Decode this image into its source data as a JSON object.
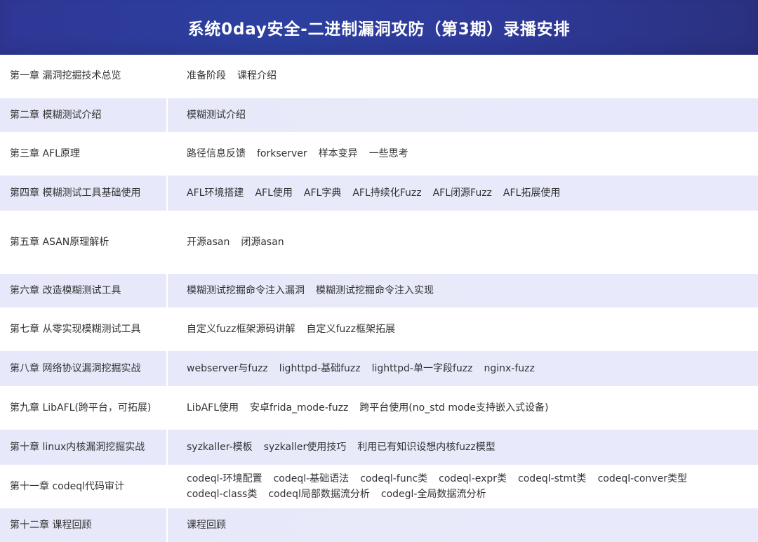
{
  "header": {
    "title": "系统0day安全-二进制漏洞攻防（第3期）录播安排"
  },
  "rows": [
    {
      "chapter": "第一章 漏洞挖掘技术总览",
      "topics": [
        "准备阶段",
        "课程介绍"
      ]
    },
    {
      "chapter": "第二章 模糊测试介绍",
      "topics": [
        "模糊测试介绍"
      ]
    },
    {
      "chapter": "第三章 AFL原理",
      "topics": [
        "路径信息反馈",
        "forkserver",
        "样本变异",
        "一些思考"
      ]
    },
    {
      "chapter": "第四章 模糊测试工具基础使用",
      "topics": [
        "AFL环境搭建",
        "AFL使用",
        "AFL字典",
        "AFL持续化Fuzz",
        "AFL闭源Fuzz",
        "AFL拓展使用"
      ]
    },
    {
      "chapter": "第五章 ASAN原理解析",
      "topics": [
        "开源asan",
        "闭源asan"
      ]
    },
    {
      "chapter": "第六章 改造模糊测试工具",
      "topics": [
        "模糊测试挖掘命令注入漏洞",
        "模糊测试挖掘命令注入实现"
      ]
    },
    {
      "chapter": "第七章 从零实现模糊测试工具",
      "topics": [
        "自定义fuzz框架源码讲解",
        "自定义fuzz框架拓展"
      ]
    },
    {
      "chapter": "第八章 网络协议漏洞挖掘实战",
      "topics": [
        "webserver与fuzz",
        "lighttpd-基础fuzz",
        "lighttpd-单一字段fuzz",
        "nginx-fuzz"
      ]
    },
    {
      "chapter": "第九章 LibAFL(跨平台，可拓展)",
      "topics": [
        "LibAFL使用",
        "安卓frida_mode-fuzz",
        "跨平台使用(no_std mode支持嵌入式设备)"
      ]
    },
    {
      "chapter": "第十章 linux内核漏洞挖掘实战",
      "topics": [
        "syzkaller-模板",
        "syzkaller使用技巧",
        "利用已有知识设想内核fuzz模型"
      ]
    },
    {
      "chapter": "第十一章 codeql代码审计",
      "topics": [
        "codeql-环境配置",
        "codeql-基础语法",
        "codeql-func类",
        "codeql-expr类",
        "codeql-stmt类",
        "codeql-conver类型",
        "codeql-class类",
        "codeql局部数据流分析",
        "codegl-全局数据流分析"
      ]
    },
    {
      "chapter": "第十二章  课程回顾",
      "topics": [
        "课程回顾"
      ]
    }
  ]
}
